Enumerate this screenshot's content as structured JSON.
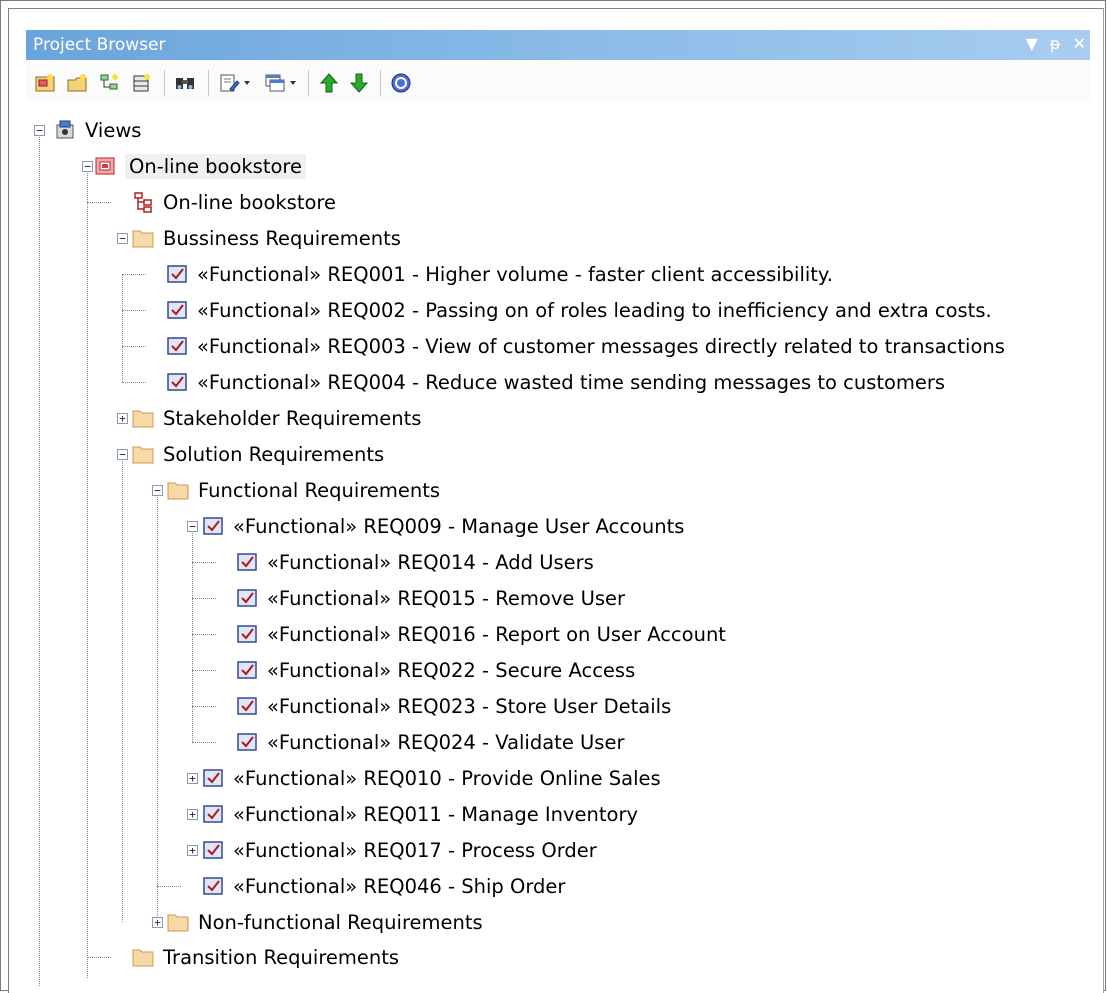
{
  "window": {
    "title": "Project Browser",
    "buttons": [
      {
        "icon": "dropdown-arrow-icon",
        "label": "▼"
      },
      {
        "icon": "pin-icon",
        "label": "ᵽ"
      },
      {
        "icon": "close-icon",
        "label": "✕"
      }
    ]
  },
  "toolbar": {
    "buttons": [
      {
        "name": "new-model-button",
        "icon": "new-model-icon"
      },
      {
        "name": "new-package-button",
        "icon": "new-package-icon"
      },
      {
        "name": "new-diagram-button",
        "icon": "new-diagram-icon"
      },
      {
        "name": "new-element-button",
        "icon": "new-element-icon"
      },
      {
        "name": "find-button",
        "icon": "binoculars-icon"
      },
      {
        "name": "document-button",
        "icon": "document-edit-icon"
      },
      {
        "name": "document-dropdown",
        "icon": "chevron-down-icon"
      },
      {
        "name": "windows-button",
        "icon": "windows-icon"
      },
      {
        "name": "windows-dropdown",
        "icon": "chevron-down-icon"
      },
      {
        "name": "move-up-button",
        "icon": "arrow-up-icon"
      },
      {
        "name": "move-down-button",
        "icon": "arrow-down-icon"
      },
      {
        "name": "help-button",
        "icon": "help-icon"
      }
    ]
  },
  "tree": {
    "views": "Views",
    "bookstore_package": "On-line bookstore",
    "bookstore_diagram": "On-line bookstore",
    "business": "Bussiness Requirements",
    "req001": "«Functional» REQ001 - Higher volume - faster client accessibility.",
    "req002": "«Functional» REQ002 - Passing on of roles leading to inefficiency and extra costs.",
    "req003": "«Functional» REQ003 - View of customer messages directly related to transactions",
    "req004": "«Functional» REQ004 - Reduce wasted time sending messages to customers",
    "stakeholder": "Stakeholder Requirements",
    "solution": "Solution Requirements",
    "functional": "Functional Requirements",
    "req009": "«Functional» REQ009 - Manage User Accounts",
    "req014": "«Functional» REQ014 - Add Users",
    "req015": "«Functional» REQ015 - Remove User",
    "req016": "«Functional» REQ016 - Report on User Account",
    "req022": "«Functional» REQ022 - Secure Access",
    "req023": "«Functional» REQ023 - Store User Details",
    "req024": "«Functional» REQ024 - Validate User",
    "req010": "«Functional» REQ010 - Provide Online Sales",
    "req011": "«Functional» REQ011 - Manage Inventory",
    "req017": "«Functional» REQ017 - Process Order",
    "req046": "«Functional» REQ046 - Ship Order",
    "nonfunctional": "Non-functional Requirements",
    "transition": "Transition Requirements",
    "expand_symbol": "+",
    "collapse_symbol": "−"
  },
  "colors": {
    "titlebar_start": "#6aa4dc",
    "titlebar_end": "#a8cdf0",
    "folder_fill": "#f7d9a8",
    "folder_stroke": "#c89a50",
    "requirement_check": "#b01818"
  }
}
